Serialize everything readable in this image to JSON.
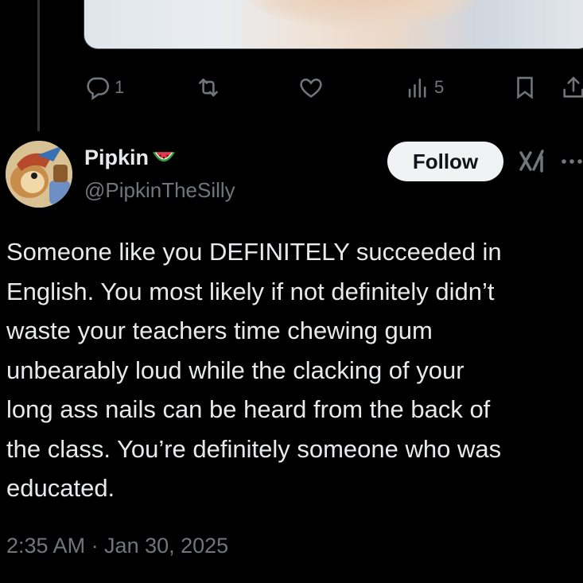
{
  "post": {
    "author_name": "Pipkin",
    "author_emoji": "watermelon-emoji",
    "handle": "@PipkinTheSilly",
    "follow_label": "Follow",
    "text": "Someone like you DEFINITELY succeeded in\nEnglish. You most likely if not definitely didn’t\nwaste your teachers time chewing gum\nunbearably loud while the clacking of your\nlong ass nails can be heard from the back of\nthe class. You’re definitely someone who was\neducated.",
    "timestamp": "2:35 AM · Jan 30, 2025"
  },
  "previous_post_actions": {
    "reply_count": "1",
    "retweet_count": "",
    "like_count": "",
    "views_count": "5"
  },
  "colors": {
    "background": "#000000",
    "text": "#e7e9ea",
    "muted": "#71767b",
    "follow_button": "#eff3f4"
  },
  "icons": [
    "reply-icon",
    "retweet-icon",
    "like-icon",
    "views-icon",
    "bookmark-icon",
    "share-icon",
    "grok-icon",
    "more-icon"
  ]
}
